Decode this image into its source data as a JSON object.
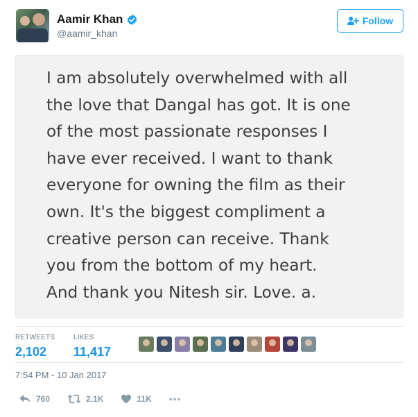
{
  "author": {
    "display_name": "Aamir Khan",
    "handle": "@aamir_khan",
    "verified_icon": "verified-badge-icon",
    "avatar_icon": "profile-photo"
  },
  "follow_button": {
    "label": "Follow",
    "icon": "add-user-icon"
  },
  "tweet_image": {
    "text_lines": [
      "I am absolutely overwhelmed with all",
      "the love that Dangal has got. It is one",
      "of the most passionate responses I",
      "have ever received. I want to thank",
      "everyone for owning the film as their",
      "own. It's the biggest compliment a",
      "creative person can receive. Thank",
      "you from the bottom of my heart.",
      "And thank you Nitesh sir. Love. a."
    ]
  },
  "stats": {
    "retweets": {
      "label": "RETWEETS",
      "value": "2,102"
    },
    "likes": {
      "label": "LIKES",
      "value": "11,417"
    }
  },
  "likers": [
    {
      "color": "#6a7c5e"
    },
    {
      "color": "#3b4f6b"
    },
    {
      "color": "#8a7fa8"
    },
    {
      "color": "#5b6e50"
    },
    {
      "color": "#4e7d9c"
    },
    {
      "color": "#2f3f57"
    },
    {
      "color": "#9c8b78"
    },
    {
      "color": "#b5463c"
    },
    {
      "color": "#3d3566"
    },
    {
      "color": "#7c8f99"
    }
  ],
  "timestamp": "7:54 PM - 10 Jan 2017",
  "actions": {
    "reply": {
      "count": "760",
      "icon": "reply-icon"
    },
    "retweet": {
      "count": "2.1K",
      "icon": "retweet-icon"
    },
    "like": {
      "count": "11K",
      "icon": "heart-icon"
    },
    "more": {
      "label": "•••",
      "icon": "more-icon"
    }
  },
  "colors": {
    "accent": "#1da1f2",
    "stat_value": "#1b95e0",
    "muted": "#657786",
    "action": "#8899a6",
    "border": "#e1e8ed"
  }
}
